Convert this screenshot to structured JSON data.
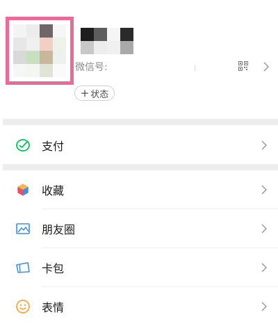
{
  "profile": {
    "wechat_id_label": "微信号:",
    "wechat_id_value": "",
    "status_plus": "+",
    "status_label": "状态"
  },
  "menu": {
    "pay": "支付",
    "favorites": "收藏",
    "moments": "朋友圈",
    "cards": "卡包",
    "stickers": "表情"
  },
  "colors": {
    "highlight_frame": "#ec6a98",
    "pay_icon": "#07c160",
    "separator": "#ededed"
  }
}
